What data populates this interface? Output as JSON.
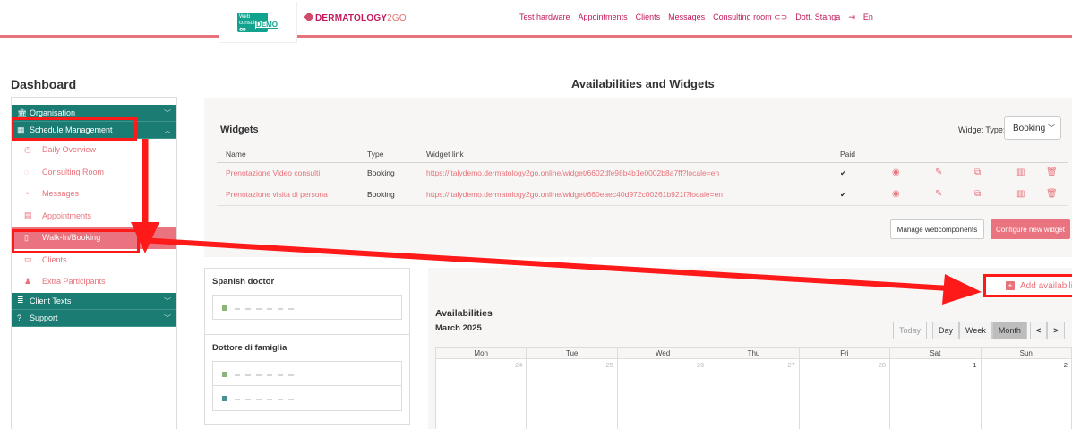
{
  "header": {
    "logo_small": "Web consult",
    "logo_demo": "DEMO",
    "brand_main": "DERMATOLOGY",
    "brand_suffix": "2GO",
    "nav": [
      "Test hardware",
      "Appointments",
      "Clients",
      "Messages",
      "Consulting room",
      "Dott. Stanga",
      "En"
    ]
  },
  "page": {
    "dashboard_title": "Dashboard",
    "main_title": "Availabilities and Widgets"
  },
  "sidebar": {
    "groups": [
      {
        "label": "Organisation",
        "icon": "building-icon"
      },
      {
        "label": "Schedule Management",
        "icon": "calendar-icon"
      },
      {
        "label": "Client Texts",
        "icon": "text-icon"
      },
      {
        "label": "Support",
        "icon": "help-icon"
      }
    ],
    "items": [
      {
        "label": "Daily Overview",
        "icon": "clock-icon"
      },
      {
        "label": "Consulting Room",
        "icon": "chat-icon"
      },
      {
        "label": "Messages",
        "icon": "message-icon"
      },
      {
        "label": "Appointments",
        "icon": "calendar-icon"
      },
      {
        "label": "Walk-In/Booking",
        "icon": "clipboard-icon",
        "active": true
      },
      {
        "label": "Clients",
        "icon": "id-card-icon"
      },
      {
        "label": "Extra Participants",
        "icon": "user-plus-icon"
      }
    ]
  },
  "widgets": {
    "title": "Widgets",
    "type_label": "Widget Type:",
    "type_value": "Booking",
    "columns": [
      "Name",
      "Type",
      "Widget link",
      "Paid"
    ],
    "rows": [
      {
        "name": "Prenotazione Video consulti",
        "type": "Booking",
        "link": "https://italydemo.dermatology2go.online/widget/6602dfe98b4b1e0002b8a7ff?locale=en",
        "paid": "✔"
      },
      {
        "name": "Prenotazione visita di persona",
        "type": "Booking",
        "link": "https://italydemo.dermatology2go.online/widget/660eaec40d972c00261b921f?locale=en",
        "paid": "✔"
      }
    ],
    "manage_label": "Manage webcomponents",
    "configure_label": "Configure new widget"
  },
  "doctors": [
    {
      "title": "Spanish doctor"
    },
    {
      "title": "Dottore di famiglia"
    }
  ],
  "availabilities": {
    "title": "Availabilities",
    "add_label": "Add availabilit",
    "month": "March 2025",
    "today": "Today",
    "views": [
      "Day",
      "Week",
      "Month"
    ],
    "prev": "<",
    "next": ">",
    "weekdays": [
      "Mon",
      "Tue",
      "Wed",
      "Thu",
      "Fri",
      "Sat",
      "Sun"
    ],
    "dates": [
      "24",
      "25",
      "26",
      "27",
      "28",
      "1",
      "2"
    ]
  },
  "colors": {
    "accent": "#e8727a",
    "sidebar_group": "#1b7c74",
    "annotation": "#ff1a1a",
    "doctor_green": "#8bb37a",
    "doctor_teal": "#4a8f94"
  }
}
